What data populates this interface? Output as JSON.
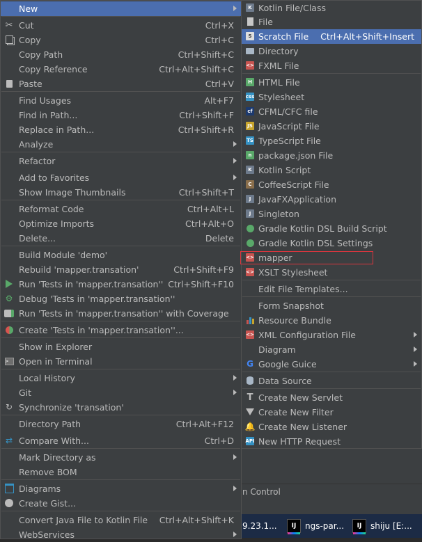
{
  "left_menu": {
    "items": [
      {
        "label": "New",
        "shortcut": "",
        "submenu": true,
        "selected": true,
        "icon": "none"
      },
      {
        "label": "Cut",
        "shortcut": "Ctrl+X",
        "icon": "scissors-icon"
      },
      {
        "label": "Copy",
        "shortcut": "Ctrl+C",
        "icon": "copy-icon"
      },
      {
        "label": "Copy Path",
        "shortcut": "Ctrl+Shift+C",
        "icon": "none"
      },
      {
        "label": "Copy Reference",
        "shortcut": "Ctrl+Alt+Shift+C",
        "icon": "none"
      },
      {
        "label": "Paste",
        "shortcut": "Ctrl+V",
        "icon": "paste-icon"
      },
      {
        "label": "Find Usages",
        "shortcut": "Alt+F7",
        "icon": "none"
      },
      {
        "label": "Find in Path...",
        "shortcut": "Ctrl+Shift+F",
        "icon": "none"
      },
      {
        "label": "Replace in Path...",
        "shortcut": "Ctrl+Shift+R",
        "icon": "none"
      },
      {
        "label": "Analyze",
        "shortcut": "",
        "submenu": true,
        "icon": "none"
      },
      {
        "label": "Refactor",
        "shortcut": "",
        "submenu": true,
        "icon": "none"
      },
      {
        "label": "Add to Favorites",
        "shortcut": "",
        "submenu": true,
        "icon": "none"
      },
      {
        "label": "Show Image Thumbnails",
        "shortcut": "Ctrl+Shift+T",
        "icon": "none"
      },
      {
        "label": "Reformat Code",
        "shortcut": "Ctrl+Alt+L",
        "icon": "none"
      },
      {
        "label": "Optimize Imports",
        "shortcut": "Ctrl+Alt+O",
        "icon": "none"
      },
      {
        "label": "Delete...",
        "shortcut": "Delete",
        "icon": "none"
      },
      {
        "label": "Build Module 'demo'",
        "shortcut": "",
        "icon": "none"
      },
      {
        "label": "Rebuild 'mapper.transation'",
        "shortcut": "Ctrl+Shift+F9",
        "icon": "none"
      },
      {
        "label": "Run 'Tests in 'mapper.transation''",
        "shortcut": "Ctrl+Shift+F10",
        "icon": "run-icon"
      },
      {
        "label": "Debug 'Tests in 'mapper.transation''",
        "shortcut": "",
        "icon": "debug-icon"
      },
      {
        "label": "Run 'Tests in 'mapper.transation'' with Coverage",
        "shortcut": "",
        "icon": "coverage-icon"
      },
      {
        "label": "Create 'Tests in 'mapper.transation''...",
        "shortcut": "",
        "icon": "create-test-icon"
      },
      {
        "label": "Show in Explorer",
        "shortcut": "",
        "icon": "none"
      },
      {
        "label": "Open in Terminal",
        "shortcut": "",
        "icon": "terminal-icon"
      },
      {
        "label": "Local History",
        "shortcut": "",
        "submenu": true,
        "icon": "none"
      },
      {
        "label": "Git",
        "shortcut": "",
        "submenu": true,
        "icon": "none"
      },
      {
        "label": "Synchronize 'transation'",
        "shortcut": "",
        "icon": "sync-icon"
      },
      {
        "label": "Directory Path",
        "shortcut": "Ctrl+Alt+F12",
        "icon": "none"
      },
      {
        "label": "Compare With...",
        "shortcut": "Ctrl+D",
        "icon": "compare-icon"
      },
      {
        "label": "Mark Directory as",
        "shortcut": "",
        "submenu": true,
        "icon": "none"
      },
      {
        "label": "Remove BOM",
        "shortcut": "",
        "icon": "none"
      },
      {
        "label": "Diagrams",
        "shortcut": "",
        "submenu": true,
        "icon": "diagram-icon"
      },
      {
        "label": "Create Gist...",
        "shortcut": "",
        "icon": "github-icon"
      },
      {
        "label": "Convert Java File to Kotlin File",
        "shortcut": "Ctrl+Alt+Shift+K",
        "icon": "none"
      },
      {
        "label": "WebServices",
        "shortcut": "",
        "submenu": true,
        "icon": "none"
      }
    ]
  },
  "new_submenu": {
    "items": [
      {
        "label": "Kotlin File/Class",
        "shortcut": "",
        "icon": "kotlin-file-icon"
      },
      {
        "label": "File",
        "shortcut": "",
        "icon": "file-icon"
      },
      {
        "label": "Scratch File",
        "shortcut": "Ctrl+Alt+Shift+Insert",
        "selected": true,
        "icon": "scratch-file-icon"
      },
      {
        "label": "Directory",
        "shortcut": "",
        "icon": "folder-icon"
      },
      {
        "label": "FXML File",
        "shortcut": "",
        "icon": "fxml-icon"
      },
      {
        "label": "HTML File",
        "shortcut": "",
        "icon": "html-icon"
      },
      {
        "label": "Stylesheet",
        "shortcut": "",
        "icon": "css-icon"
      },
      {
        "label": "CFML/CFC file",
        "shortcut": "",
        "icon": "cfml-icon"
      },
      {
        "label": "JavaScript File",
        "shortcut": "",
        "icon": "js-icon"
      },
      {
        "label": "TypeScript File",
        "shortcut": "",
        "icon": "ts-icon"
      },
      {
        "label": "package.json File",
        "shortcut": "",
        "icon": "npm-icon"
      },
      {
        "label": "Kotlin Script",
        "shortcut": "",
        "icon": "kotlin-script-icon"
      },
      {
        "label": "CoffeeScript File",
        "shortcut": "",
        "icon": "coffee-icon"
      },
      {
        "label": "JavaFXApplication",
        "shortcut": "",
        "icon": "javafx-icon"
      },
      {
        "label": "Singleton",
        "shortcut": "",
        "icon": "singleton-icon"
      },
      {
        "label": "Gradle Kotlin DSL Build Script",
        "shortcut": "",
        "icon": "gradle-icon"
      },
      {
        "label": "Gradle Kotlin DSL Settings",
        "shortcut": "",
        "icon": "gradle-icon"
      },
      {
        "label": "mapper",
        "shortcut": "",
        "icon": "xml-icon",
        "highlighted": true
      },
      {
        "label": "XSLT Stylesheet",
        "shortcut": "",
        "icon": "xslt-icon"
      },
      {
        "label": "Edit File Templates...",
        "shortcut": "",
        "icon": "none"
      },
      {
        "label": "Form Snapshot",
        "shortcut": "",
        "icon": "none"
      },
      {
        "label": "Resource Bundle",
        "shortcut": "",
        "icon": "resource-bundle-icon"
      },
      {
        "label": "XML Configuration File",
        "shortcut": "",
        "submenu": true,
        "icon": "xml-config-icon"
      },
      {
        "label": "Diagram",
        "shortcut": "",
        "submenu": true,
        "icon": "none"
      },
      {
        "label": "Google Guice",
        "shortcut": "",
        "submenu": true,
        "icon": "google-icon"
      },
      {
        "label": "Data Source",
        "shortcut": "",
        "icon": "database-icon"
      },
      {
        "label": "Create New Servlet",
        "shortcut": "",
        "icon": "servlet-icon"
      },
      {
        "label": "Create New Filter",
        "shortcut": "",
        "icon": "filter-icon"
      },
      {
        "label": "Create New Listener",
        "shortcut": "",
        "icon": "listener-icon"
      },
      {
        "label": "New HTTP Request",
        "shortcut": "",
        "icon": "api-icon"
      }
    ]
  },
  "background": {
    "tool_window_label": "n Control",
    "taskbar": [
      {
        "label": "9.23.1..."
      },
      {
        "label": "ngs-par..."
      },
      {
        "label": "shiju [E:..."
      }
    ]
  },
  "colors": {
    "menu_bg": "#3c3f41",
    "selection": "#4b6eaf",
    "text": "#bbbbbb",
    "highlight_box": "#d9363e"
  }
}
